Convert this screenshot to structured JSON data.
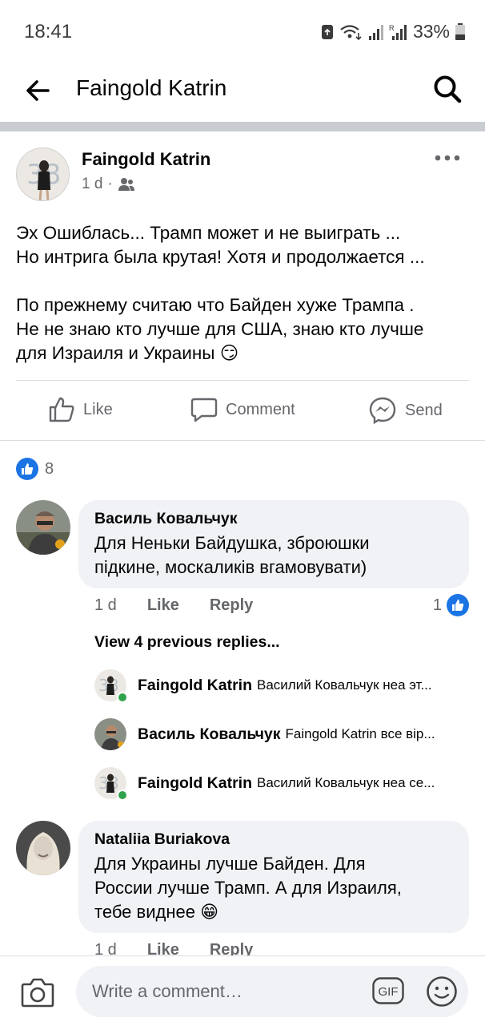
{
  "status_bar": {
    "time": "18:41",
    "battery": "33%"
  },
  "header": {
    "title": "Faingold Katrin",
    "icons": [
      "back-arrow-icon",
      "search-icon"
    ]
  },
  "post": {
    "author": "Faingold Katrin",
    "time": "1 d",
    "audience_icon": "friends-icon",
    "paragraph1_line1": "Эх Ошиблась... Трамп может и не выиграть ...",
    "paragraph1_line2": "Но интрига была крутая! Хотя и продолжается ...",
    "paragraph2_line1": "По прежнему считаю что Байден хуже Трампа .",
    "paragraph2_line2": "Не не знаю кто лучше для США, знаю кто лучше",
    "paragraph2_line3": "для Израиля и Украины 😏",
    "actions": {
      "like": "Like",
      "comment": "Comment",
      "send": "Send"
    },
    "reaction_count": "8"
  },
  "comments": [
    {
      "author": "Василь Ковальчук",
      "text_line1": "Для Неньки Байдушка, зброюшки",
      "text_line2": "підкине, москаликів вгамовувати)",
      "time": "1 d",
      "like": "Like",
      "reply": "Reply",
      "reactions": "1"
    },
    {
      "author": "Nataliia Buriakova",
      "text_line1": "Для Украины лучше Байден. Для",
      "text_line2": "России лучше Трамп. А для Израиля,",
      "text_line3": "тебе виднее 😁",
      "time": "1 d",
      "like": "Like",
      "reply": "Reply"
    }
  ],
  "replies": {
    "view_previous": "View 4 previous replies...",
    "items": [
      {
        "author": "Faingold Katrin",
        "text": "Василий Ковальчук неа эт..."
      },
      {
        "author": "Василь Ковальчук",
        "text": "Faingold Katrin все вір..."
      },
      {
        "author": "Faingold Katrin",
        "text": "Василий Ковальчук неа се..."
      }
    ]
  },
  "composer": {
    "placeholder": "Write a comment…",
    "gif_label": "GIF"
  },
  "colors": {
    "accent": "#1b74e4",
    "secondary_text": "#65676b",
    "bubble": "#f0f2f5",
    "online": "#31a24c"
  }
}
